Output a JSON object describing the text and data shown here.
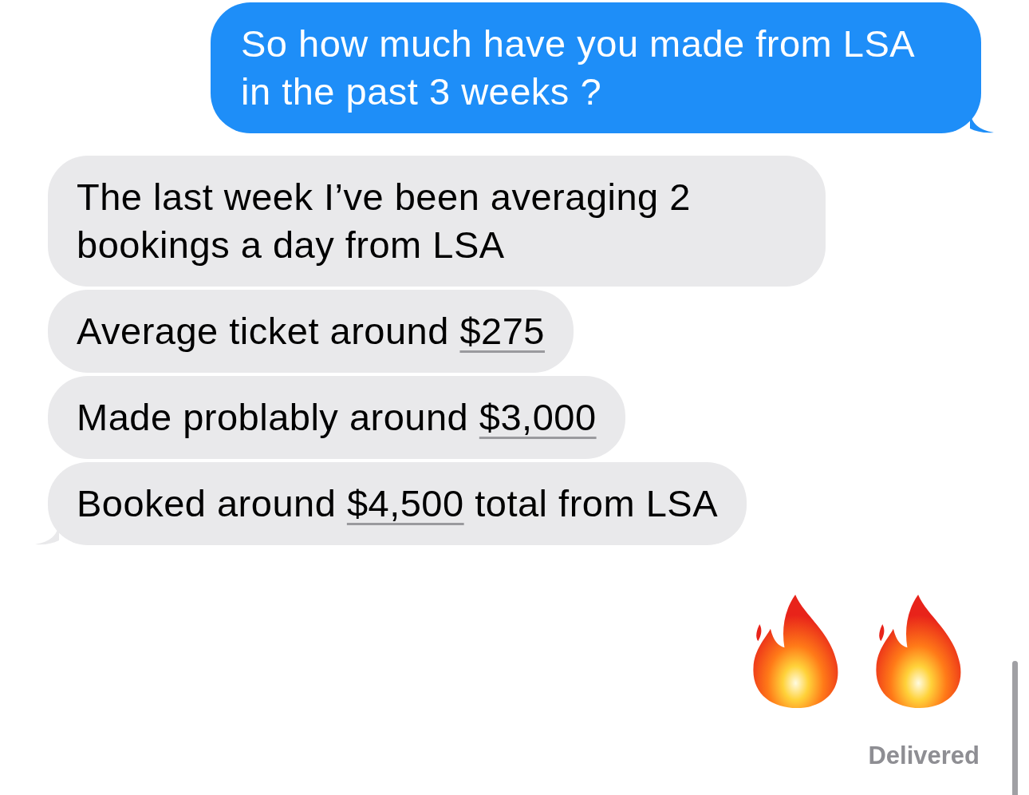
{
  "messages": [
    {
      "kind": "sent",
      "parts": [
        {
          "text": "So how much have you made from LSA in the past 3 weeks ?",
          "link": false
        }
      ],
      "tail": true
    },
    {
      "kind": "received",
      "parts": [
        {
          "text": "The last week I’ve been averaging 2 bookings a day from LSA",
          "link": false
        }
      ],
      "tail": false
    },
    {
      "kind": "received",
      "parts": [
        {
          "text": "Average ticket around ",
          "link": false
        },
        {
          "text": "$275",
          "link": true
        }
      ],
      "tail": false
    },
    {
      "kind": "received",
      "parts": [
        {
          "text": "Made problably around ",
          "link": false
        },
        {
          "text": "$3,000",
          "link": true
        }
      ],
      "tail": false
    },
    {
      "kind": "received",
      "parts": [
        {
          "text": "Booked around ",
          "link": false
        },
        {
          "text": "$4,500",
          "link": true
        },
        {
          "text": " total from LSA",
          "link": false
        }
      ],
      "tail": true
    }
  ],
  "emoji": [
    {
      "kind": "fire"
    },
    {
      "kind": "fire"
    }
  ],
  "status": "Delivered"
}
